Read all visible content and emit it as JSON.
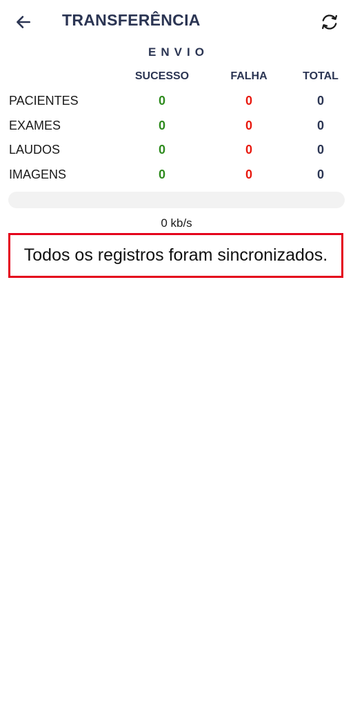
{
  "header": {
    "title": "TRANSFERÊNCIA",
    "back_icon": "arrow-left-icon",
    "sync_icon": "refresh-icon"
  },
  "section": {
    "title": "ENVIO"
  },
  "table": {
    "columns": [
      "SUCESSO",
      "FALHA",
      "TOTAL"
    ],
    "rows": [
      {
        "label": "PACIENTES",
        "success": "0",
        "fail": "0",
        "total": "0"
      },
      {
        "label": "EXAMES",
        "success": "0",
        "fail": "0",
        "total": "0"
      },
      {
        "label": "LAUDOS",
        "success": "0",
        "fail": "0",
        "total": "0"
      },
      {
        "label": "IMAGENS",
        "success": "0",
        "fail": "0",
        "total": "0"
      }
    ]
  },
  "progress": {
    "value_percent": 0,
    "speed": "0 kb/s"
  },
  "status": {
    "message": "Todos os registros foram sincronizados."
  },
  "colors": {
    "primary": "#2b3553",
    "success": "#2e8b1e",
    "fail": "#e8190f",
    "highlight_border": "#e4001b"
  }
}
